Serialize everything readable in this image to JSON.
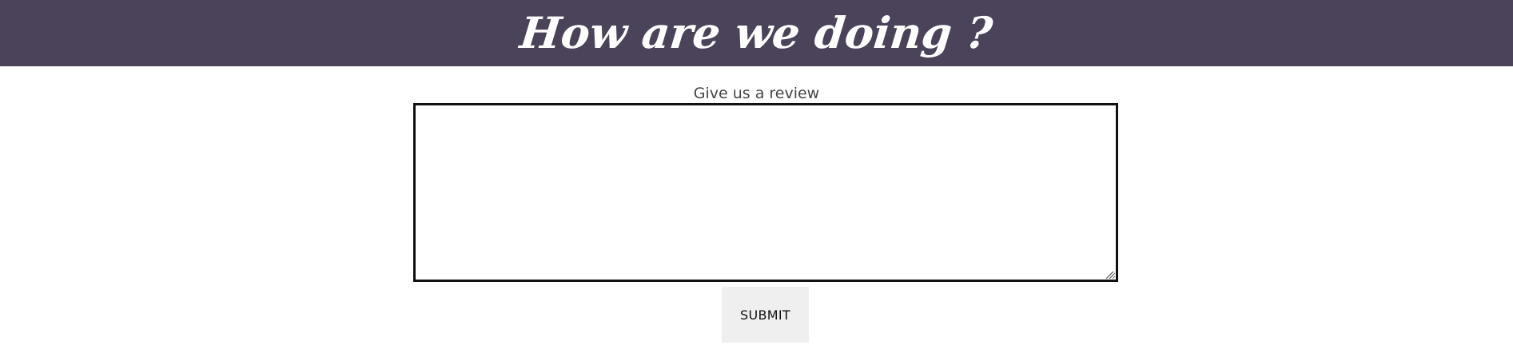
{
  "header": {
    "title": "How are we doing ?",
    "background_color": "#4a435a"
  },
  "review": {
    "label": "Give us a review",
    "textarea_value": "",
    "resize_icon": "resize-grip-icon"
  },
  "actions": {
    "submit_label": "SUBMIT"
  }
}
